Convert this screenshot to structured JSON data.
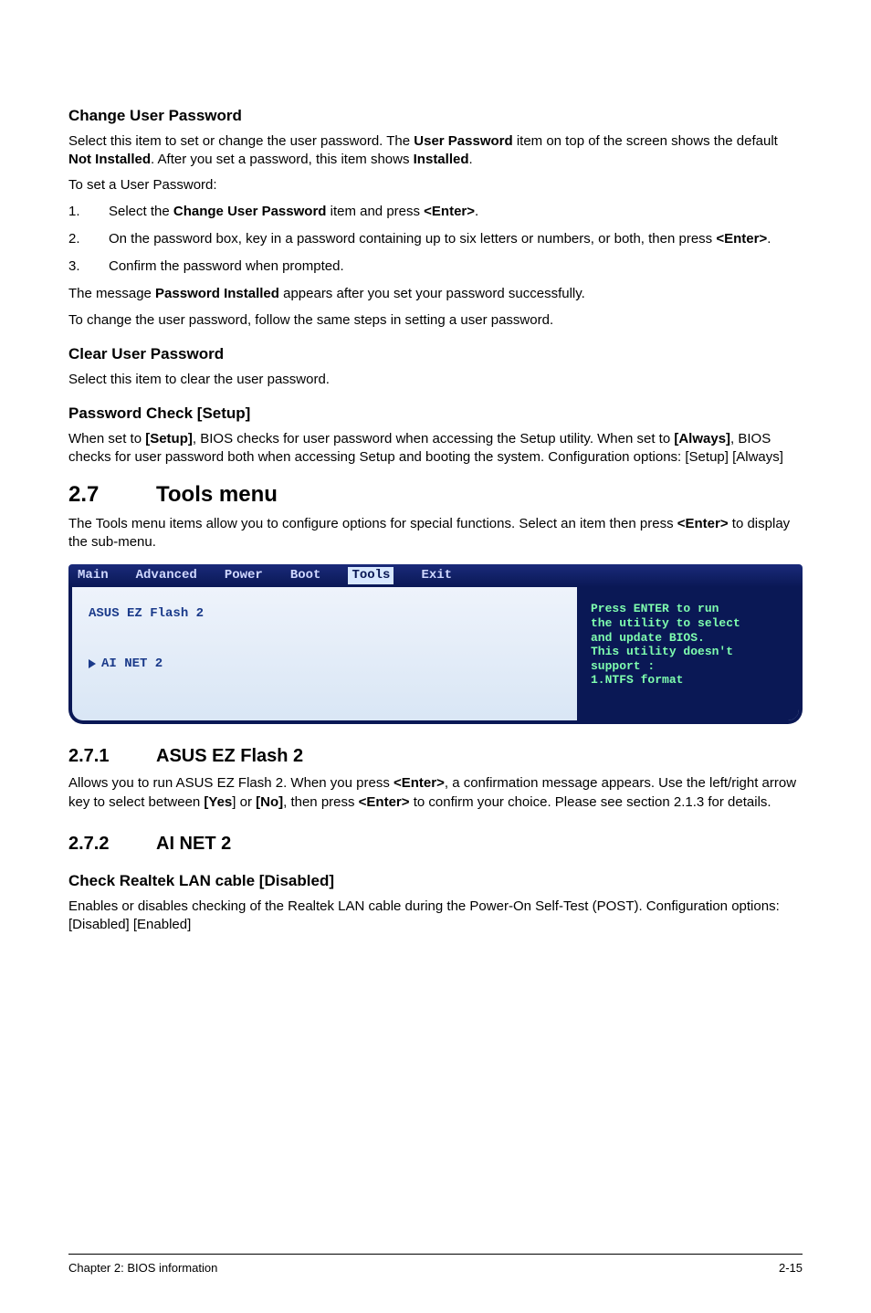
{
  "s1": {
    "h": "Change User Password",
    "p1a": "Select this item to set or change the user password. The ",
    "p1b": "User Password",
    "p1c": " item on top of the screen shows the default ",
    "p1d": "Not Installed",
    "p1e": ". After you set a password, this item shows ",
    "p1f": "Installed",
    "p1g": ".",
    "p2": "To set a User Password:",
    "li1a": "Select the ",
    "li1b": "Change User Password",
    "li1c": " item and press ",
    "li1d": "<Enter>",
    "li1e": ".",
    "li2a": "On the password box, key in a password containing up to six letters or numbers, or both, then press ",
    "li2b": "<Enter>",
    "li2c": ".",
    "li3": "Confirm the password when prompted.",
    "p3a": "The message ",
    "p3b": "Password Installed",
    "p3c": " appears after you set your password successfully.",
    "p4": "To change the user password, follow the same steps in setting a user password."
  },
  "s2": {
    "h": "Clear User Password",
    "p": "Select this item to clear the user password."
  },
  "s3": {
    "h": "Password Check [Setup]",
    "pa": "When set to ",
    "pb": "[Setup]",
    "pc": ", BIOS checks for user password when accessing the Setup utility. When set to ",
    "pd": "[Always]",
    "pe": ", BIOS checks for user password both when accessing Setup and booting the system. Configuration options: [Setup] [Always]"
  },
  "sec27": {
    "num": "2.7",
    "title": "Tools menu",
    "pa": "The Tools menu items allow you to configure options for special functions. Select an item then press ",
    "pb": "<Enter>",
    "pc": " to display the sub-menu."
  },
  "bios": {
    "tabs": [
      "Main",
      "Advanced",
      "Power",
      "Boot",
      "Tools",
      "Exit"
    ],
    "active_index": 4,
    "left1": "ASUS EZ Flash 2",
    "left2": "AI NET 2",
    "right": "Press ENTER to run\nthe utility to select\nand update BIOS.\nThis utility doesn't\nsupport :\n1.NTFS format"
  },
  "sec271": {
    "num": "2.7.1",
    "title": "ASUS EZ Flash 2",
    "pa": "Allows you to run ASUS EZ Flash 2. When you press ",
    "pb": "<Enter>",
    "pc": ", a confirmation message appears. Use the left/right arrow key to select between ",
    "pd": "[Yes",
    "pe": "] or ",
    "pf": "[No]",
    "pg": ", then press ",
    "ph": "<Enter>",
    "pi": " to confirm your choice. Please see section 2.1.3 for details."
  },
  "sec272": {
    "num": "2.7.2",
    "title": "AI NET 2",
    "h": "Check Realtek LAN cable [Disabled]",
    "p": "Enables or disables checking of the Realtek LAN cable during the Power-On Self-Test (POST). Configuration options: [Disabled] [Enabled]"
  },
  "footer": {
    "left": "Chapter 2: BIOS information",
    "right": "2-15"
  },
  "nums": {
    "n1": "1.",
    "n2": "2.",
    "n3": "3."
  }
}
